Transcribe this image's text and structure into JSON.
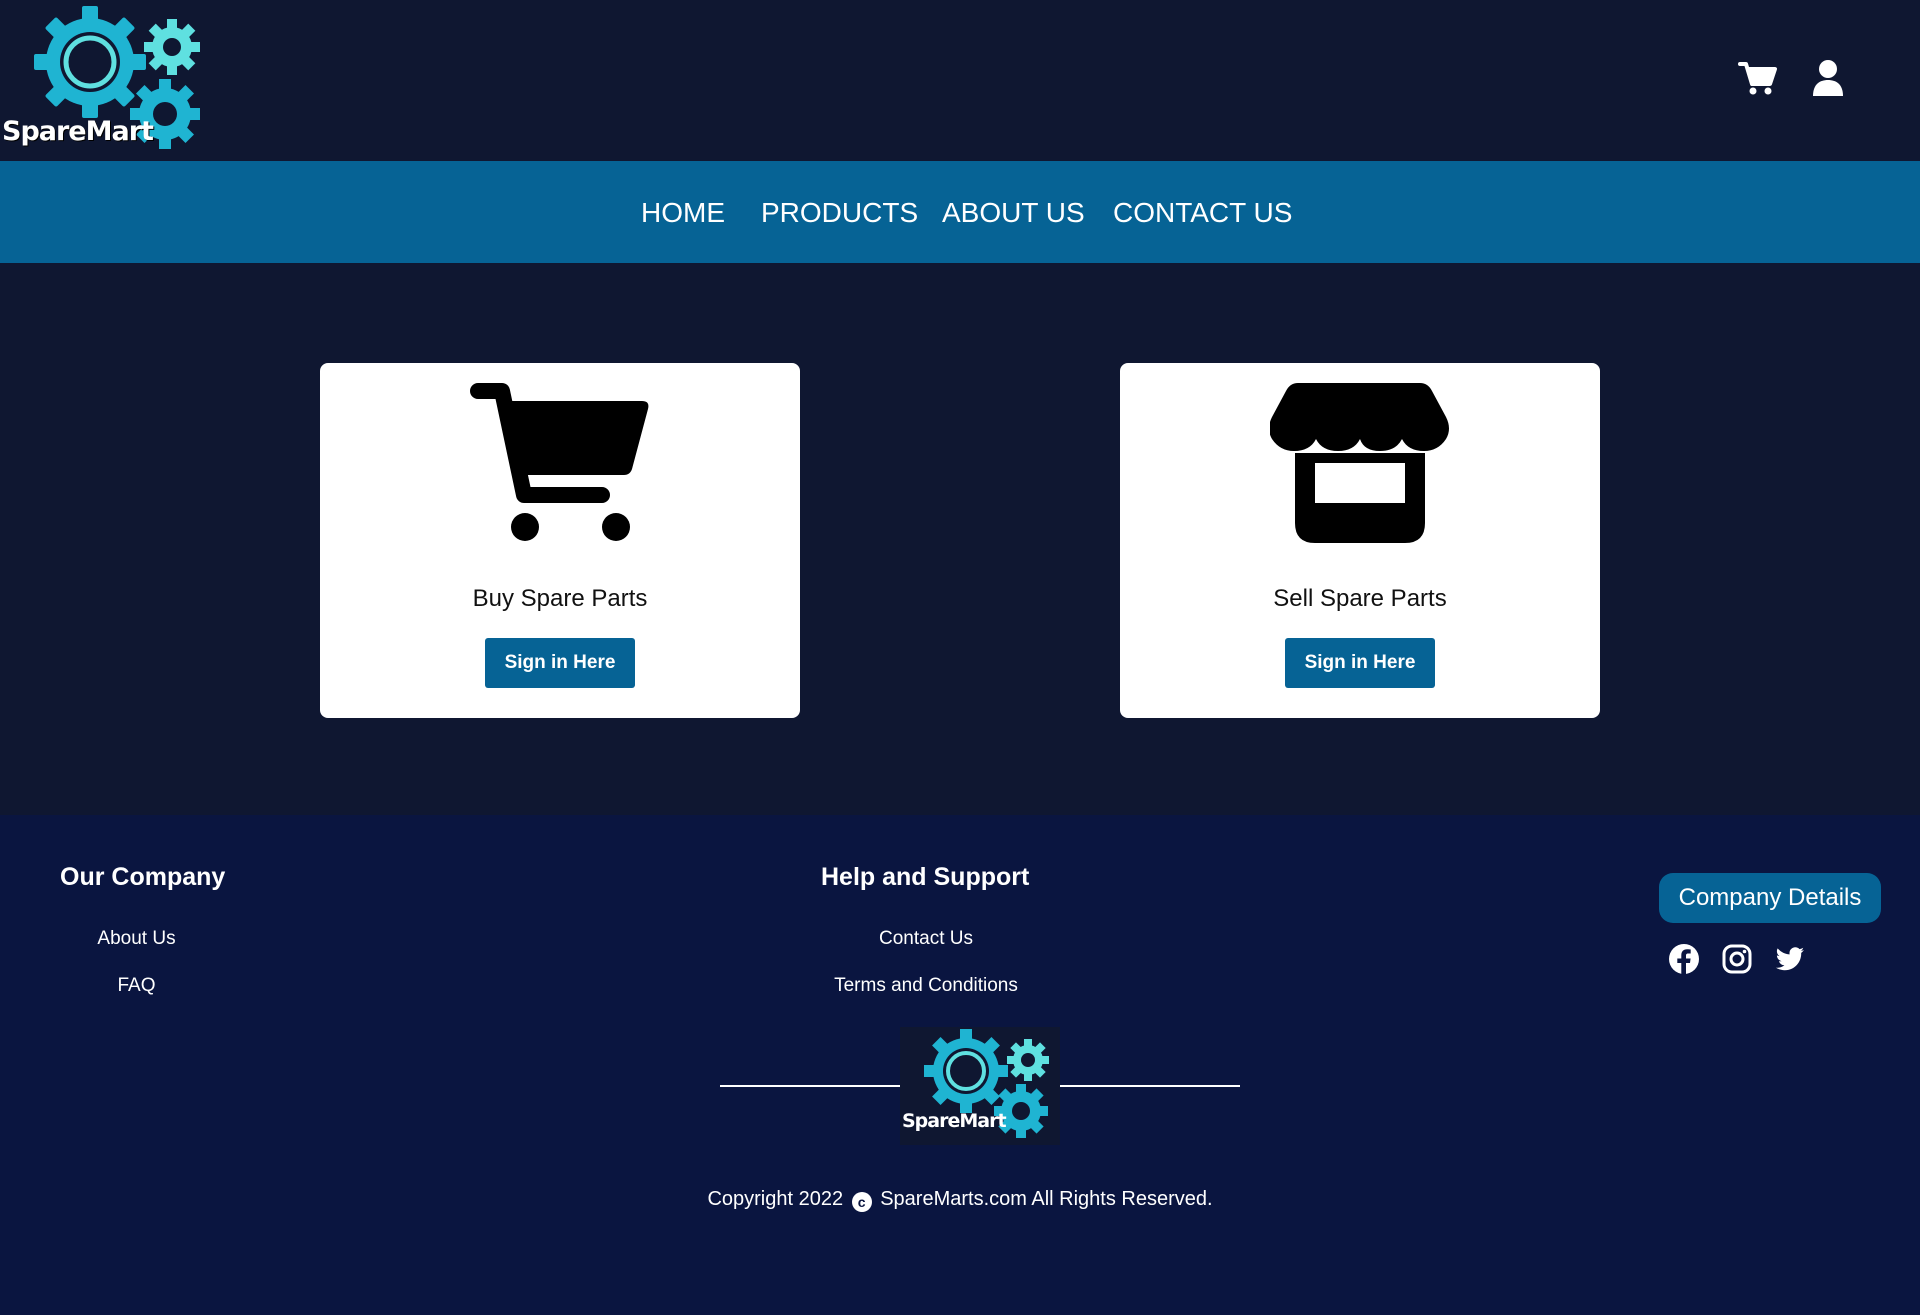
{
  "header": {
    "logo_text": "SpareMart"
  },
  "nav": {
    "items": [
      {
        "label": "HOME"
      },
      {
        "label": "PRODUCTS"
      },
      {
        "label": "ABOUT US"
      },
      {
        "label": "CONTACT US"
      }
    ]
  },
  "cards": [
    {
      "title": "Buy Spare Parts",
      "button": "Sign in Here",
      "icon": "cart-icon"
    },
    {
      "title": "Sell Spare Parts",
      "button": "Sign in Here",
      "icon": "store-icon"
    }
  ],
  "footer": {
    "company_heading": "Our Company",
    "company_links": [
      "About Us",
      "FAQ"
    ],
    "help_heading": "Help and Support",
    "help_links": [
      "Contact Us",
      "Terms and Conditions"
    ],
    "company_details_button": "Company Details",
    "social_icons": [
      "facebook-icon",
      "instagram-icon",
      "twitter-icon"
    ],
    "logo_text": "SpareMart",
    "copyright_prefix": "Copyright 2022",
    "copyright_suffix": "SpareMarts.com All Rights Reserved."
  },
  "colors": {
    "background": "#0f1731",
    "nav": "#066395",
    "footer": "#0a1540",
    "gear_primary": "#1fb4d2",
    "gear_secondary": "#5fe0e0"
  }
}
